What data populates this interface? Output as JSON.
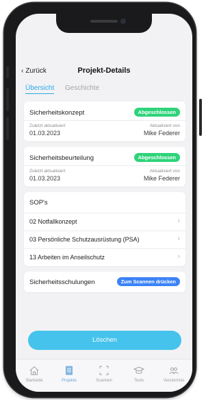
{
  "nav": {
    "back_label": "Zurück",
    "title": "Projekt-Details"
  },
  "tabs": [
    {
      "label": "Übersicht",
      "active": true
    },
    {
      "label": "Geschichte",
      "active": false
    }
  ],
  "cards": [
    {
      "title": "Sicherheitskonzept",
      "status": "Abgeschlossen",
      "updated_label": "Zuletzt aktualisiert",
      "updated_value": "01.03.2023",
      "by_label": "Aktualisiert von",
      "by_value": "Mike Federer"
    },
    {
      "title": "Sicherheitsbeurteilung",
      "status": "Abgeschlossen",
      "updated_label": "Zuletzt aktualisiert",
      "updated_value": "01.03.2023",
      "by_label": "Aktualisiert von",
      "by_value": "Mike Federer"
    }
  ],
  "sop": {
    "header": "SOP's",
    "items": [
      "02 Notfallkonzept",
      "03 Persönliche Schutzausrüstung (PSA)",
      "13 Arbeiten im Anseilschutz"
    ]
  },
  "training": {
    "title": "Sicherheitsschulungen",
    "action_label": "Zum Scannen drücken"
  },
  "delete_label": "Löschen",
  "tabbar": [
    {
      "label": "Startseite",
      "icon": "home-icon"
    },
    {
      "label": "Projekte",
      "icon": "document-icon",
      "active": true
    },
    {
      "label": "Scannen",
      "icon": "scan-icon"
    },
    {
      "label": "Tests",
      "icon": "graduation-cap-icon"
    },
    {
      "label": "Verzeichnis",
      "icon": "people-icon"
    }
  ],
  "colors": {
    "accent": "#2aa8e6",
    "button": "#45c3ec",
    "badge_green": "#2ed37a",
    "badge_blue": "#3b82f6",
    "background": "#f2f2f5"
  }
}
